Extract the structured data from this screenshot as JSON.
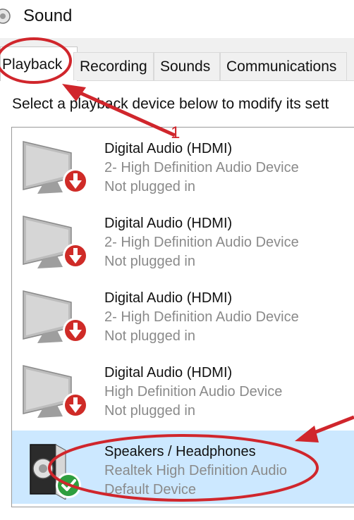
{
  "window": {
    "title": "Sound"
  },
  "tabs": [
    {
      "label": "Playback",
      "active": true
    },
    {
      "label": "Recording",
      "active": false
    },
    {
      "label": "Sounds",
      "active": false
    },
    {
      "label": "Communications",
      "active": false
    }
  ],
  "instruction": "Select a playback device below to modify its sett",
  "devices": [
    {
      "name": "Digital Audio (HDMI)",
      "description": "2- High Definition Audio Device",
      "status": "Not plugged in",
      "icon": "monitor-icon",
      "badge": "unplugged-arrow-icon"
    },
    {
      "name": "Digital Audio (HDMI)",
      "description": "2- High Definition Audio Device",
      "status": "Not plugged in",
      "icon": "monitor-icon",
      "badge": "unplugged-arrow-icon"
    },
    {
      "name": "Digital Audio (HDMI)",
      "description": "2- High Definition Audio Device",
      "status": "Not plugged in",
      "icon": "monitor-icon",
      "badge": "unplugged-arrow-icon"
    },
    {
      "name": "Digital Audio (HDMI)",
      "description": "High Definition Audio Device",
      "status": "Not plugged in",
      "icon": "monitor-icon",
      "badge": "unplugged-arrow-icon"
    },
    {
      "name": "Speakers / Headphones",
      "description": "Realtek High Definition Audio",
      "status": "Default Device",
      "icon": "speaker-icon",
      "badge": "default-check-icon",
      "selected": true
    }
  ],
  "annotation": {
    "label": "1",
    "color": "#d0262c"
  },
  "colors": {
    "selection": "#cce8ff",
    "unplugged_badge": "#cf2b27",
    "default_badge": "#2e9e3e"
  }
}
